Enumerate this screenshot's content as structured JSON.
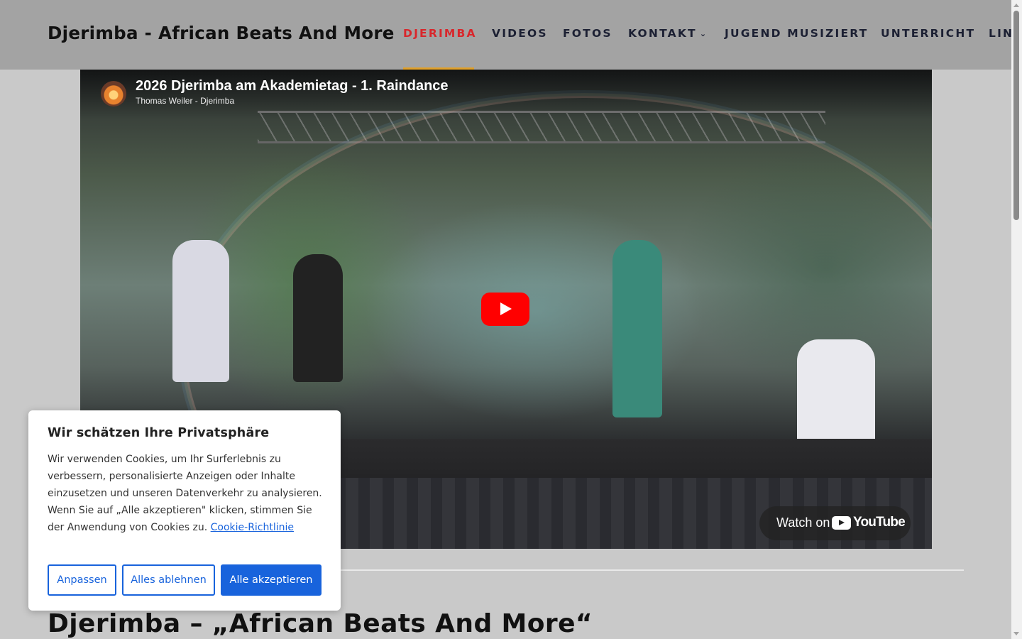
{
  "site": {
    "title": "Djerimba - African Beats And More"
  },
  "nav": {
    "items": [
      {
        "label": "DJERIMBA",
        "active": true
      },
      {
        "label": "VIDEOS"
      },
      {
        "label": "FOTOS"
      },
      {
        "label": "KONTAKT",
        "has_dropdown": true
      },
      {
        "label": "JUGEND MUSIZIERT"
      },
      {
        "label": "UNTERRICHT"
      },
      {
        "label": "LIN"
      }
    ],
    "dropdown_glyph": "⌄",
    "active_color": "#d9262b",
    "underline_color": "#e0a02a"
  },
  "video": {
    "title": "2026 Djerimba am Akademietag - 1. Raindance",
    "channel": "Thomas Weiler - Djerimba",
    "watch_on": "Watch on",
    "youtube_word": "YouTube",
    "play_button_color": "#ff0000"
  },
  "main": {
    "heading": "Djerimba – „African Beats And More“"
  },
  "cookie": {
    "title": "Wir schätzen Ihre Privatsphäre",
    "text": "Wir verwenden Cookies, um Ihr Surferlebnis zu verbessern, personalisierte Anzeigen oder Inhalte einzusetzen und unseren Datenverkehr zu analysieren. Wenn Sie auf „Alle akzeptieren\" klicken, stimmen Sie der Anwendung von Cookies zu.",
    "link": "Cookie-Richtlinie",
    "buttons": {
      "customize": "Anpassen",
      "reject": "Alles ablehnen",
      "accept": "Alle akzeptieren"
    },
    "accent_color": "#1863dc"
  }
}
